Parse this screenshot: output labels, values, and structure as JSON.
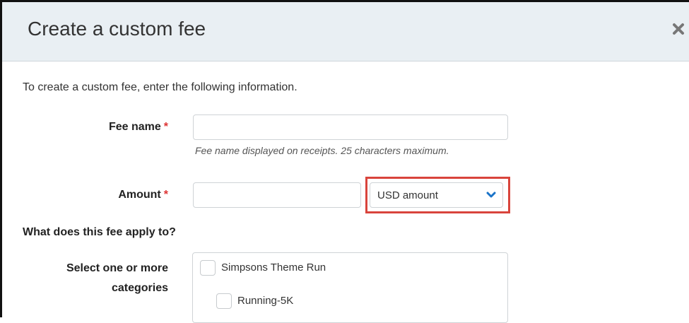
{
  "dialog": {
    "title": "Create a custom fee",
    "close_icon": "close-icon"
  },
  "intro": "To create a custom fee, enter the following information.",
  "fee_name": {
    "label": "Fee name",
    "required_mark": "*",
    "value": "",
    "placeholder": "",
    "hint": "Fee name displayed on receipts. 25 characters maximum."
  },
  "amount": {
    "label": "Amount",
    "required_mark": "*",
    "value": "",
    "placeholder": "",
    "type_selected": "USD amount",
    "dropdown_icon": "chevron-down-icon"
  },
  "applies_to": {
    "heading": "What does this fee apply to?",
    "categories_label": "Select one or more categories",
    "categories": [
      {
        "label": "Simpsons Theme Run",
        "checked": false
      },
      {
        "label": "Running-5K",
        "checked": false
      }
    ]
  },
  "colors": {
    "header_bg": "#e9eff3",
    "required": "#dd3333",
    "highlight": "#d9443c",
    "chevron": "#1a73c8"
  }
}
